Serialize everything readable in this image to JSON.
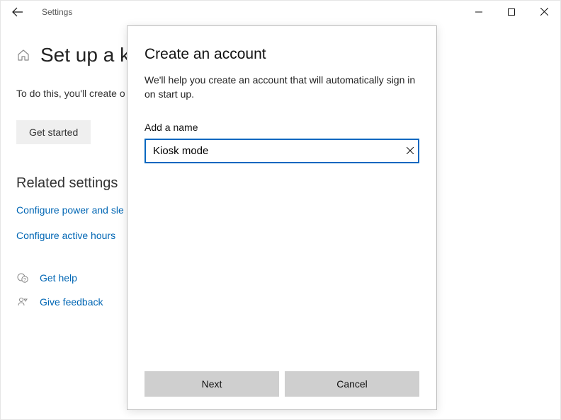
{
  "titlebar": {
    "app_title": "Settings"
  },
  "page": {
    "title": "Set up a k",
    "body": "To do this, you'll create o only app that it can use (",
    "get_started": "Get started",
    "related_heading": "Related settings",
    "links": {
      "power_sleep": "Configure power and sle",
      "active_hours": "Configure active hours"
    },
    "help": {
      "get_help": "Get help",
      "give_feedback": "Give feedback"
    }
  },
  "modal": {
    "title": "Create an account",
    "description": "We'll help you create an account that will automatically sign in on start up.",
    "field_label": "Add a name",
    "name_value": "Kiosk mode",
    "next": "Next",
    "cancel": "Cancel"
  }
}
